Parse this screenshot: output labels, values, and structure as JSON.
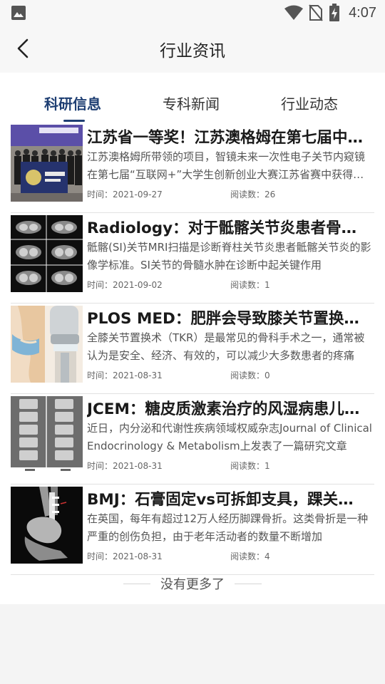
{
  "status_bar": {
    "time": "4:07",
    "icons": [
      "photo-icon",
      "wifi-icon",
      "no-sim-icon",
      "battery-charging-icon"
    ]
  },
  "header": {
    "title": "行业资讯",
    "back_icon": "chevron-left-icon"
  },
  "tabs": [
    {
      "label": "科研信息",
      "active": true
    },
    {
      "label": "专科新闻",
      "active": false
    },
    {
      "label": "行业动态",
      "active": false
    }
  ],
  "articles": [
    {
      "title": "江苏省一等奖！江苏澳格姆在第七届中国“互联网+”",
      "summary": "江苏澳格姆所带领的项目，智镜未来一次性电子关节内窥镜在第七届“互联网+”大学生创新创业大赛江苏省赛中获得一等奖",
      "time": "时间：2021-09-27",
      "reads": "阅读数：26",
      "thumb": "group-photo"
    },
    {
      "title": "Radiology：对于骶髂关节炎患者骨髓水肿的MRI诊断",
      "summary": "骶髂(SI)关节MRI扫描是诊断脊柱关节炎患者骶髂关节炎的影像学标准。SI关节的骨髓水肿在诊断中起关键作用",
      "time": "时间：2021-09-02",
      "reads": "阅读数：1",
      "thumb": "mri-scan"
    },
    {
      "title": "PLOS MED：肥胖会导致膝关节置换术后的并发症吗",
      "summary": "全膝关节置换术（TKR）是最常见的骨科手术之一，通常被认为是安全、经济、有效的，可以减少大多数患者的疼痛",
      "time": "时间：2021-08-31",
      "reads": "阅读数：0",
      "thumb": "knee-implant"
    },
    {
      "title": "JCEM：糖皮质激素治疗的风湿病患儿的骨折风险",
      "summary": "近日，内分泌和代谢性疾病领域权威杂志Journal of Clinical Endocrinology & Metabolism上发表了一篇研究文章",
      "time": "时间：2021-08-31",
      "reads": "阅读数：1",
      "thumb": "spine-xray"
    },
    {
      "title": "BMJ：石膏固定vs可拆卸支具，踝关节骨折的治疗",
      "summary": "在英国，每年有超过12万人经历脚踝骨折。这类骨折是一种严重的创伤负担，由于老年活动者的数量不断增加",
      "time": "时间：2021-08-31",
      "reads": "阅读数：4",
      "thumb": "ankle-xray"
    }
  ],
  "footer": {
    "no_more": "没有更多了"
  }
}
